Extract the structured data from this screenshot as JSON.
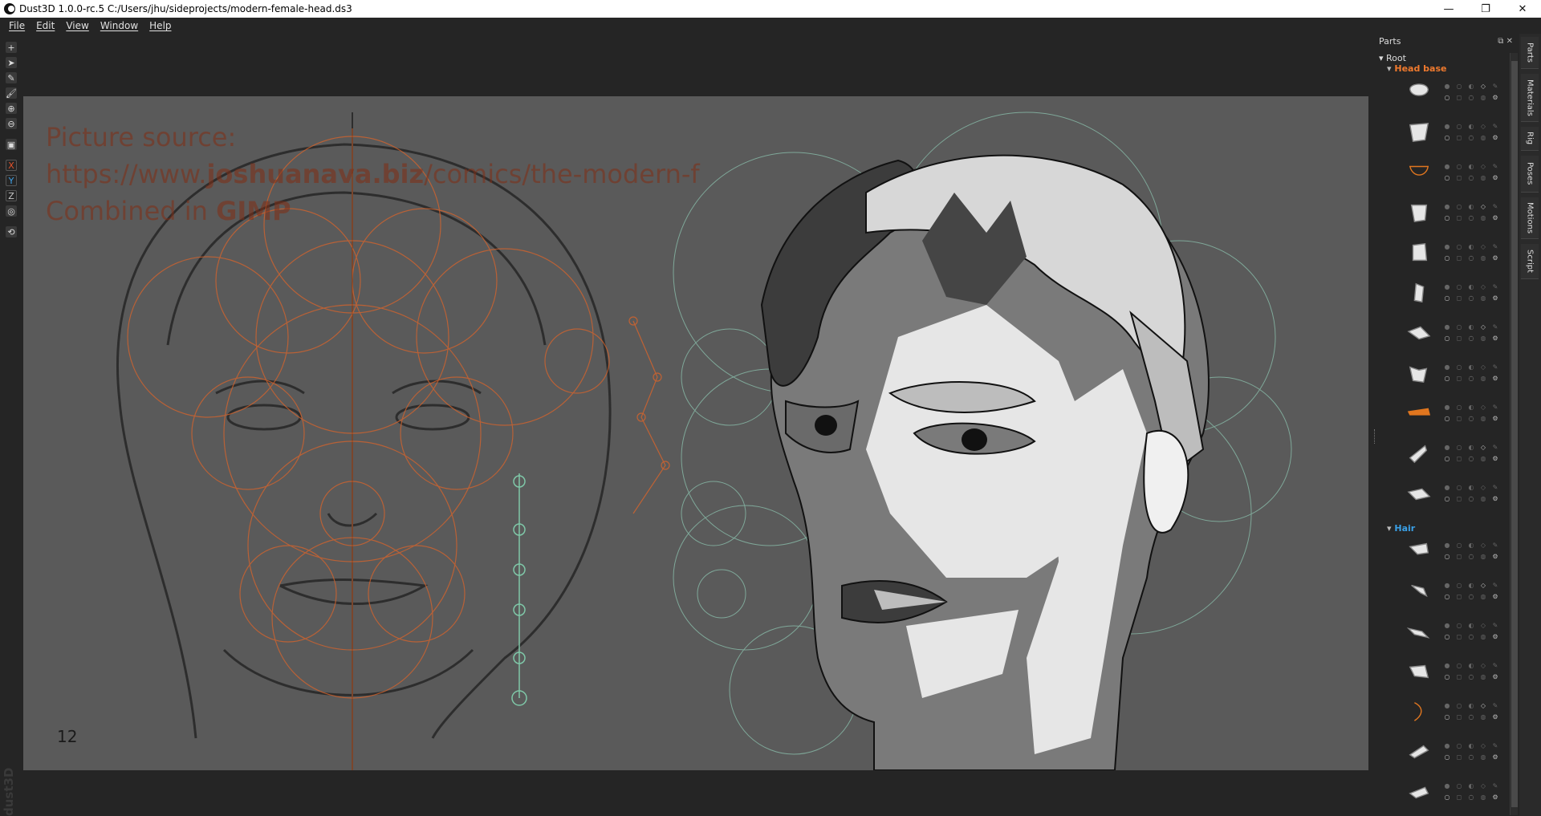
{
  "window": {
    "title": "Dust3D 1.0.0-rc.5 C:/Users/jhu/sideprojects/modern-female-head.ds3",
    "controls": {
      "minimize": "—",
      "maximize": "❐",
      "close": "✕"
    }
  },
  "menu": [
    "File",
    "Edit",
    "View",
    "Window",
    "Help"
  ],
  "toolbar": {
    "add": "+",
    "select": "➤",
    "edit": "✎",
    "paint": "🖌",
    "zoom_in": "⊕",
    "zoom_out": "⊖",
    "fit": "▣",
    "axis_x": "X",
    "axis_y": "Y",
    "axis_z": "Z",
    "radius": "◎",
    "camera": "⟲"
  },
  "canvas": {
    "overlay_line1": "Picture source:",
    "overlay_line2_pre": "https://www.",
    "overlay_line2_bold": "joshuanava.biz",
    "overlay_line2_post": "/comics/the-modern-f",
    "overlay_line3_pre": "Combined in ",
    "overlay_line3_bold": "GIMP",
    "page_number": "12",
    "watermark": "dust3D"
  },
  "parts": {
    "title": "Parts",
    "header_controls": "⧉ ✕",
    "root": "Root",
    "groups": [
      {
        "label": "Head base",
        "color": "#f07a2e"
      },
      {
        "label": "Hair",
        "color": "#3aa0e6"
      }
    ]
  },
  "side_tabs": [
    "Parts",
    "Materials",
    "Rig",
    "Poses",
    "Motions",
    "Script"
  ],
  "colors": {
    "accent_orange": "#f07a2e",
    "accent_blue": "#3aa0e6",
    "background": "#252525",
    "viewport": "#5a5a5a"
  }
}
